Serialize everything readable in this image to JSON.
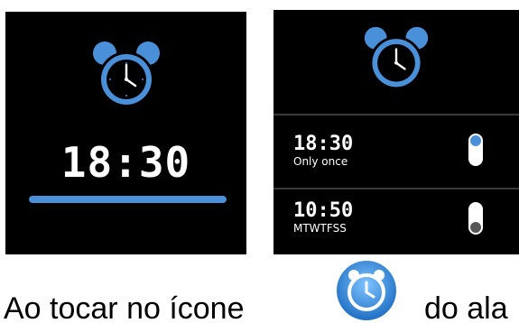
{
  "colors": {
    "accent": "#4a90d9",
    "screen_background": "#000000",
    "toggle_on": "#4a90d9",
    "toggle_off": "#555555",
    "text": "#ffffff"
  },
  "alarm_screen": {
    "icon": "alarm-clock-icon",
    "time": "18:30",
    "progress": 1.0
  },
  "alarm_list": {
    "icon": "alarm-clock-icon",
    "items": [
      {
        "time": "18:30",
        "repeat": "Only once",
        "enabled": true
      },
      {
        "time": "10:50",
        "repeat": "MTWTFSS",
        "enabled": false
      }
    ]
  },
  "caption": {
    "text_before": "Ao tocar no ícone",
    "icon": "alarm-app-icon",
    "text_after": "do ala"
  }
}
